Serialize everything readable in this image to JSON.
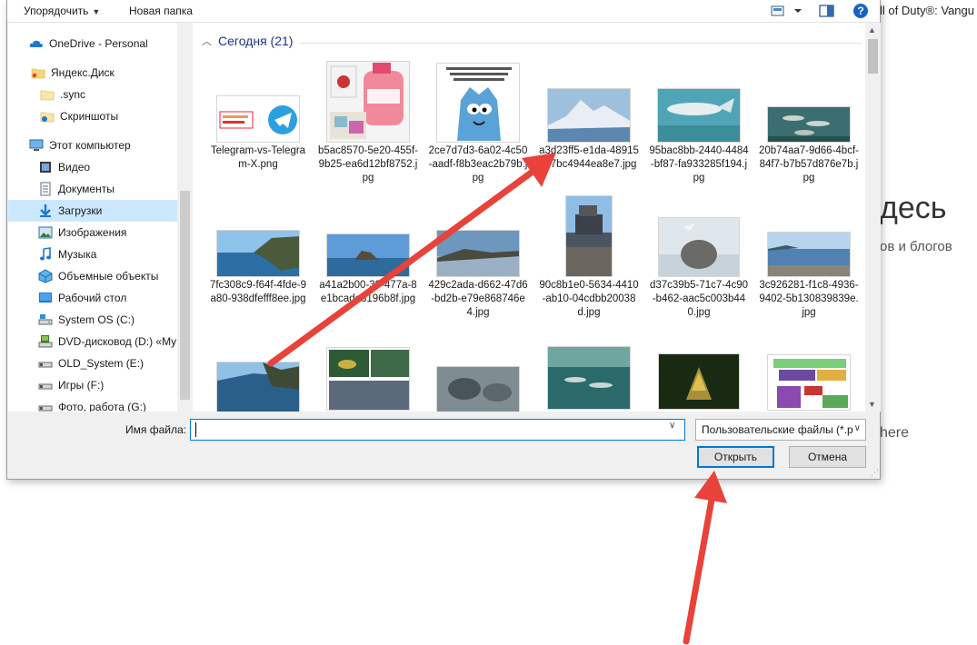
{
  "background": {
    "tab_text": "ll of Duty®: Vangu",
    "heading": "десь",
    "subtext": "ов и блогов",
    "here_text": "here"
  },
  "toolbar": {
    "organize_label": "Упорядочить",
    "new_folder_label": "Новая папка"
  },
  "nav": {
    "items": [
      {
        "label": "OneDrive - Personal",
        "icon": "cloud-icon"
      },
      {
        "label": "Яндекс.Диск",
        "icon": "folder-icon"
      },
      {
        "label": ".sync",
        "icon": "folder-icon"
      },
      {
        "label": "Скриншоты",
        "icon": "folder-icon"
      },
      {
        "label": "Этот компьютер",
        "icon": "computer-icon"
      },
      {
        "label": "Видео",
        "icon": "video-icon"
      },
      {
        "label": "Документы",
        "icon": "documents-icon"
      },
      {
        "label": "Загрузки",
        "icon": "download-icon"
      },
      {
        "label": "Изображения",
        "icon": "pictures-icon"
      },
      {
        "label": "Музыка",
        "icon": "music-icon"
      },
      {
        "label": "Объемные объекты",
        "icon": "3d-objects-icon"
      },
      {
        "label": "Рабочий стол",
        "icon": "desktop-icon"
      },
      {
        "label": "System OS (C:)",
        "icon": "drive-icon"
      },
      {
        "label": "DVD-дисковод (D:) «My",
        "icon": "dvd-icon"
      },
      {
        "label": "OLD_System (E:)",
        "icon": "drive-icon"
      },
      {
        "label": "Игры (F:)",
        "icon": "drive-icon"
      },
      {
        "label": "Фото, работа (G:)",
        "icon": "drive-icon"
      }
    ],
    "selected": "Загрузки"
  },
  "group": {
    "title": "Сегодня (21)"
  },
  "files": [
    {
      "name": "Telegram-vs-Telegram-X.png"
    },
    {
      "name": "b5ac8570-5e20-455f-9b25-ea6d12bf8752.jpg"
    },
    {
      "name": "2ce7d7d3-6a02-4c50-aadf-f8b3eac2b79b.jpg"
    },
    {
      "name": "a3d23ff5-e1da-48915b-7bc4944ea8e7.jpg"
    },
    {
      "name": "95bac8bb-2440-4484-bf87-fa933285f194.jpg"
    },
    {
      "name": "20b74aa7-9d66-4bcf-84f7-b7b57d876e7b.jpg"
    },
    {
      "name": "7fc308c9-f64f-4fde-9a80-938dfefff8ee.jpg"
    },
    {
      "name": "a41a2b00-39-477a-8e1bcada3196b8f.jpg"
    },
    {
      "name": "429c2ada-d662-47d6-bd2b-e79e868746e4.jpg"
    },
    {
      "name": "90c8b1e0-5634-4410-ab10-04cdbb20038d.jpg"
    },
    {
      "name": "d37c39b5-71c7-4c90-b462-aac5c003b440.jpg"
    },
    {
      "name": "3c926281-f1c8-4936-9402-5b130839839e.jpg"
    }
  ],
  "bottom": {
    "filename_label": "Имя файла:",
    "filename_value": "",
    "filter_value": "Пользовательские файлы (*.p",
    "open_label": "Открыть",
    "cancel_label": "Отмена"
  },
  "colors": {
    "accent": "#0078d7",
    "selected_bg": "#cce8ff",
    "arrow": "#e8423a"
  }
}
